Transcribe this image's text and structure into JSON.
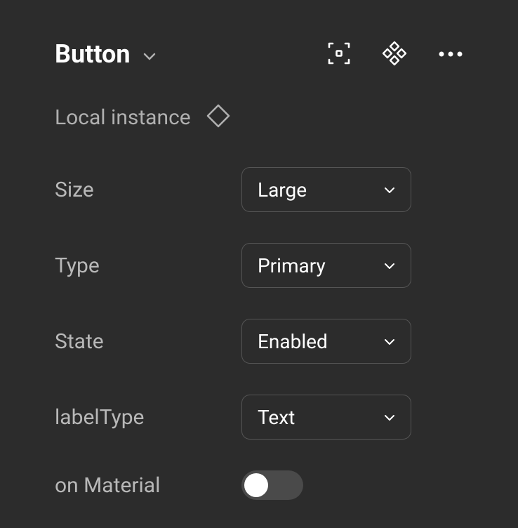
{
  "header": {
    "title": "Button"
  },
  "instance": {
    "label": "Local instance"
  },
  "properties": {
    "size": {
      "label": "Size",
      "value": "Large"
    },
    "type": {
      "label": "Type",
      "value": "Primary"
    },
    "state": {
      "label": "State",
      "value": "Enabled"
    },
    "labelType": {
      "label": "labelType",
      "value": "Text"
    },
    "onMaterial": {
      "label": "on Material",
      "value": false
    }
  }
}
